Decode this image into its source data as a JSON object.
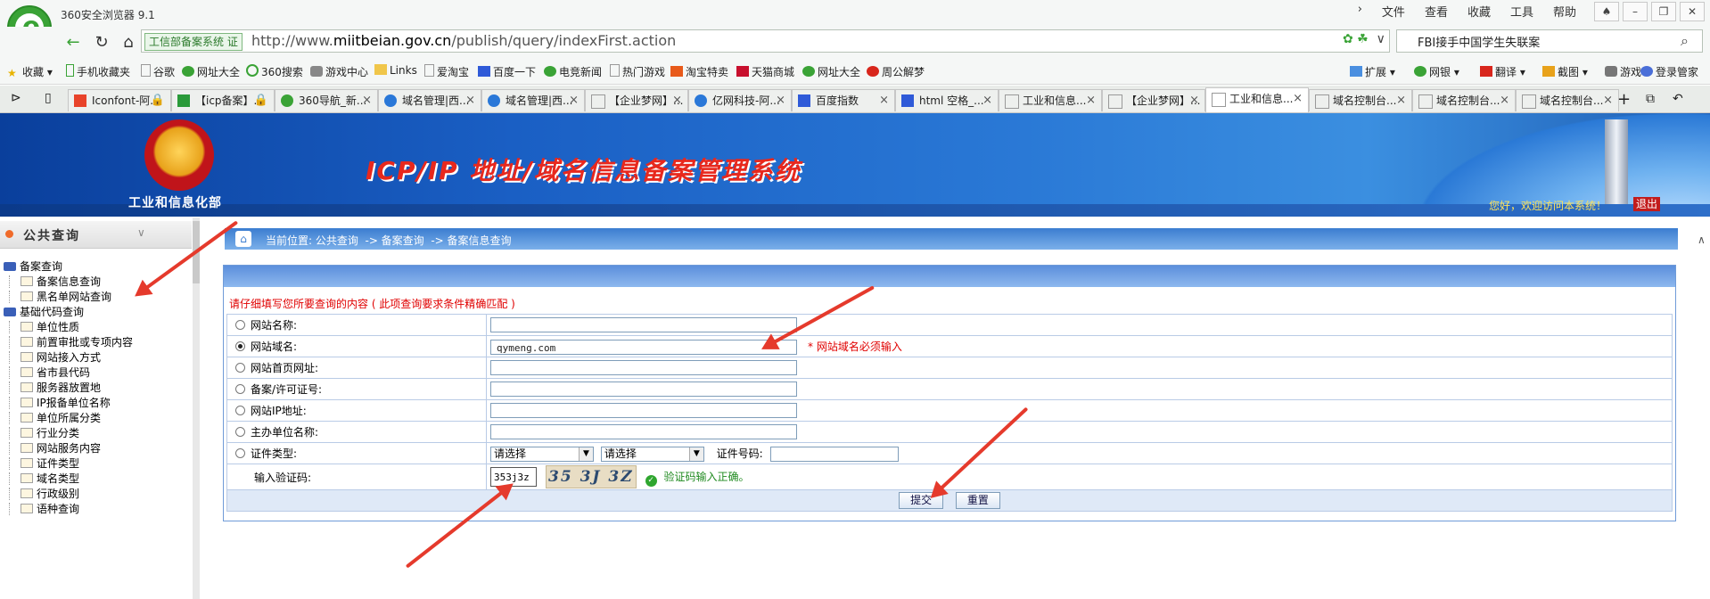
{
  "browser": {
    "title": "360安全浏览器 9.1",
    "menu": [
      "文件",
      "查看",
      "收藏",
      "工具",
      "帮助"
    ],
    "window_controls": [
      "shirt-icon",
      "minimize-icon",
      "restore-icon",
      "close-icon"
    ],
    "site_badge": "工信部备案系统",
    "url_prefix": "http://www.",
    "url_domain": "miitbeian.gov.cn",
    "url_path": "/publish/query/indexFirst.action",
    "search_value": "FBI接手中国学生失联案",
    "bookmarks": [
      "收藏",
      "手机收藏夹",
      "谷歌",
      "网址大全",
      "360搜索",
      "游戏中心",
      "Links",
      "爱淘宝",
      "百度一下",
      "电竞新闻",
      "热门游戏",
      "淘宝特卖",
      "天猫商城",
      "网址大全",
      "周公解梦"
    ],
    "toolbar_right": [
      "扩展",
      "网银",
      "翻译",
      "截图",
      "游戏",
      "登录管家"
    ],
    "tabs": [
      "Iconfont-阿...",
      "【icp备案】...",
      "360导航_新...",
      "域名管理|西...",
      "域名管理|西...",
      "【企业梦网】...",
      "亿网科技-阿...",
      "百度指数",
      "html 空格_...",
      "工业和信息...",
      "【企业梦网】...",
      "工业和信息...",
      "域名控制台...",
      "域名控制台...",
      "域名控制台..."
    ],
    "active_tab_index": 11
  },
  "banner": {
    "ministry": "工业和信息化部",
    "system_title": "ICP/IP 地址/域名信息备案管理系统",
    "welcome": "您好，欢迎访问本系统！",
    "logout": "退出"
  },
  "sidebar": {
    "title": "公共查询",
    "groups": [
      {
        "label": "备案查询",
        "items": [
          "备案信息查询",
          "黑名单网站查询"
        ]
      },
      {
        "label": "基础代码查询",
        "items": [
          "单位性质",
          "前置审批或专项内容",
          "网站接入方式",
          "省市县代码",
          "服务器放置地",
          "IP报备单位名称",
          "单位所属分类",
          "行业分类",
          "网站服务内容",
          "证件类型",
          "域名类型",
          "行政级别",
          "语种查询"
        ]
      }
    ]
  },
  "breadcrumb": "当前位置: 公共查询  -> 备案查询  -> 备案信息查询",
  "form": {
    "hint": "请仔细填写您所要查询的内容 ( 此项查询要求条件精确匹配 )",
    "rows": [
      {
        "label": "网站名称:",
        "value": "",
        "selected": false
      },
      {
        "label": "网站域名:",
        "value": "qymeng.com",
        "selected": true,
        "required_note": "* 网站域名必须输入"
      },
      {
        "label": "网站首页网址:",
        "value": "",
        "selected": false
      },
      {
        "label": "备案/许可证号:",
        "value": "",
        "selected": false
      },
      {
        "label": "网站IP地址:",
        "value": "",
        "selected": false
      },
      {
        "label": "主办单位名称:",
        "value": "",
        "selected": false
      }
    ],
    "cert_row": {
      "label": "证件类型:",
      "select1": "请选择",
      "select2": "请选择",
      "cert_no_label": "证件号码:",
      "cert_no_value": ""
    },
    "captcha": {
      "label": "输入验证码:",
      "value": "353j3z",
      "image_text": "35 3J 3Z",
      "status": "验证码输入正确。"
    },
    "submit": "提交",
    "reset": "重置"
  }
}
